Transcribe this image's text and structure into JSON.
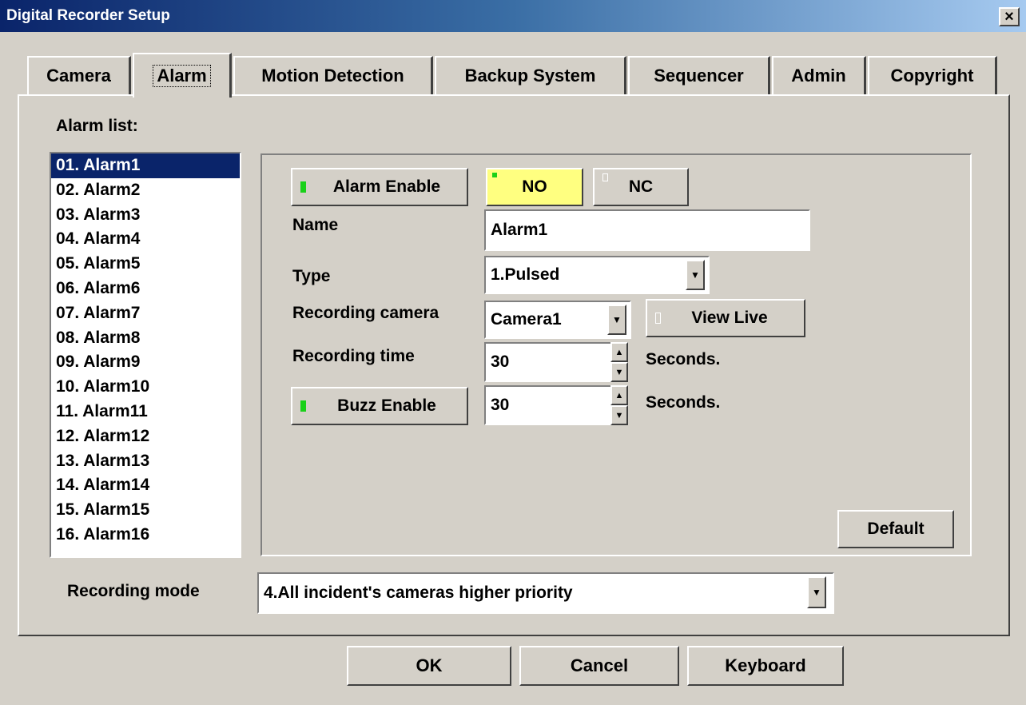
{
  "window": {
    "title": "Digital Recorder Setup",
    "close_glyph": "×"
  },
  "tabs": [
    {
      "label": "Camera",
      "active": false
    },
    {
      "label": "Alarm",
      "active": true
    },
    {
      "label": "Motion Detection",
      "active": false
    },
    {
      "label": "Backup System",
      "active": false
    },
    {
      "label": "Sequencer",
      "active": false
    },
    {
      "label": "Admin",
      "active": false
    },
    {
      "label": "Copyright",
      "active": false
    }
  ],
  "alarm_list": {
    "label": "Alarm list:",
    "selected_index": 0,
    "items": [
      "01. Alarm1",
      "02. Alarm2",
      "03. Alarm3",
      "04. Alarm4",
      "05. Alarm5",
      "06. Alarm6",
      "07. Alarm7",
      "08. Alarm8",
      "09. Alarm9",
      "10. Alarm10",
      "11. Alarm11",
      "12. Alarm12",
      "13. Alarm13",
      "14. Alarm14",
      "15. Alarm15",
      "16. Alarm16"
    ]
  },
  "details": {
    "alarm_enable_label": "Alarm Enable",
    "no_label": "NO",
    "nc_label": "NC",
    "name_label": "Name",
    "name_value": "Alarm1",
    "type_label": "Type",
    "type_value": "1.Pulsed",
    "recording_camera_label": "Recording camera",
    "recording_camera_value": "Camera1",
    "view_live_label": "View Live",
    "recording_time_label": "Recording time",
    "recording_time_value": "30",
    "recording_time_unit": "Seconds.",
    "buzz_enable_label": "Buzz Enable",
    "buzz_time_value": "30",
    "buzz_time_unit": "Seconds.",
    "default_label": "Default"
  },
  "recording_mode": {
    "label": "Recording mode",
    "value": "4.All incident's cameras higher priority"
  },
  "footer": {
    "ok_label": "OK",
    "cancel_label": "Cancel",
    "keyboard_label": "Keyboard"
  },
  "icons": {
    "dropdown_arrow": "▼",
    "spin_up": "▲",
    "spin_down": "▼"
  },
  "colors": {
    "face": "#d4d0c8",
    "title_start": "#0a246a",
    "title_end": "#a6caf0",
    "selection": "#0a246a",
    "led_on": "#19d119",
    "highlight_yellow": "#ffff80"
  }
}
